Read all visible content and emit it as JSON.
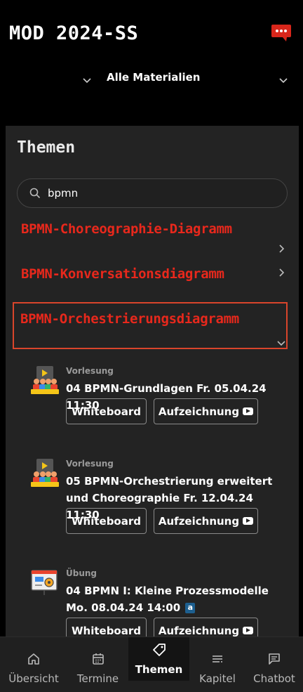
{
  "header": {
    "title": "MOD 2024-SS",
    "chat_icon": "speech-bubble-ellipsis-icon"
  },
  "filter": {
    "selected": "Alle Materialien"
  },
  "panel": {
    "title": "Themen",
    "search": {
      "value": "bpmn",
      "placeholder": ""
    },
    "topics": [
      {
        "label": "BPMN-Choreographie-Diagramm",
        "expanded": false
      },
      {
        "label": "BPMN-Konversationsdiagramm",
        "expanded": false
      },
      {
        "label": "BPMN-Orchestrierungsdiagramm",
        "expanded": true
      }
    ],
    "materials": [
      {
        "type": "Vorlesung",
        "title": "04 BPMN-Grundlagen Fr. 05.04.24 11:30",
        "whiteboard": "Whiteboard",
        "recording": "Aufzeichnung"
      },
      {
        "type": "Vorlesung",
        "title": "05 BPMN-Orchestrierung erweitert und Choreographie Fr. 12.04.24 11:30",
        "whiteboard": "Whiteboard",
        "recording": "Aufzeichnung"
      },
      {
        "type": "Übung",
        "title": "04 BPMN I: Kleine Prozessmodelle Mo. 08.04.24 14:00",
        "badge": "a",
        "whiteboard": "Whiteboard",
        "recording": "Aufzeichnung"
      }
    ]
  },
  "nav": {
    "items": [
      {
        "label": "Übersicht",
        "icon": "home-icon"
      },
      {
        "label": "Termine",
        "icon": "calendar-icon"
      },
      {
        "label": "Themen",
        "icon": "tag-icon",
        "active": true
      },
      {
        "label": "Kapitel",
        "icon": "list-icon"
      },
      {
        "label": "Chatbot",
        "icon": "chat-icon"
      }
    ]
  },
  "colors": {
    "accent": "#e8281c",
    "panel_bg": "#232323",
    "nav_bg": "#202020"
  }
}
